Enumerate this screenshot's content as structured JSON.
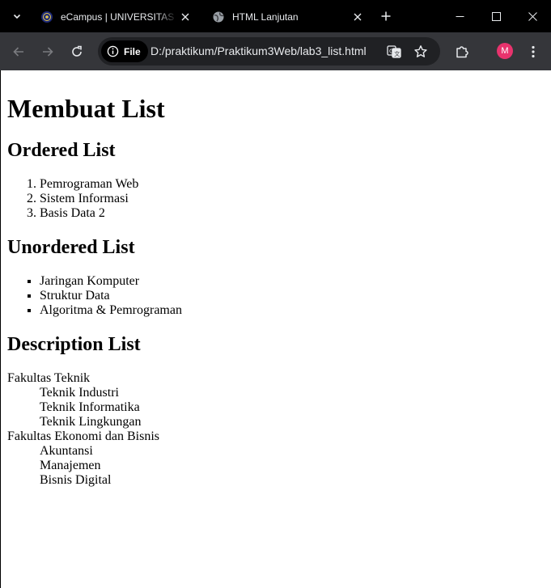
{
  "browser": {
    "tabs": [
      {
        "title": "eCampus | UNIVERSITAS P",
        "active": true,
        "icon": "university-logo-icon"
      },
      {
        "title": "HTML Lanjutan",
        "active": false,
        "icon": "globe-icon"
      }
    ],
    "address_chip": "File",
    "url": "D:/praktikum/Praktikum3Web/lab3_list.html",
    "profile_initial": "M",
    "colors": {
      "toolbar": "#35363a",
      "omnibox": "#202124",
      "avatar": "#e8336d"
    }
  },
  "page": {
    "heading": "Membuat List",
    "ordered": {
      "title": "Ordered List",
      "items": [
        "Pemrograman Web",
        "Sistem Informasi",
        "Basis Data 2"
      ]
    },
    "unordered": {
      "title": "Unordered List",
      "items": [
        "Jaringan Komputer",
        "Struktur Data",
        "Algoritma & Pemrograman"
      ]
    },
    "description": {
      "title": "Description List",
      "groups": [
        {
          "term": "Fakultas Teknik",
          "defs": [
            "Teknik Industri",
            "Teknik Informatika",
            "Teknik Lingkungan"
          ]
        },
        {
          "term": "Fakultas Ekonomi dan Bisnis",
          "defs": [
            "Akuntansi",
            "Manajemen",
            "Bisnis Digital"
          ]
        }
      ]
    }
  }
}
